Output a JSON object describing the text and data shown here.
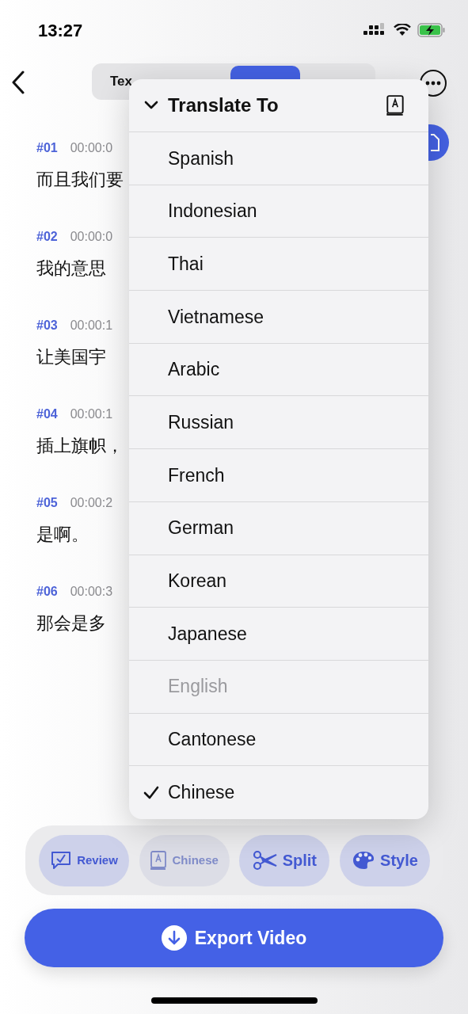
{
  "status_bar": {
    "time": "13:27"
  },
  "tabs": [
    {
      "label": "Tex",
      "selected": false
    },
    {
      "selected": true
    }
  ],
  "subtitles": [
    {
      "index": "#01",
      "time": "00:00:0",
      "text": "而且我们要"
    },
    {
      "index": "#02",
      "time": "00:00:0",
      "text": "我的意思"
    },
    {
      "index": "#03",
      "time": "00:00:1",
      "text": "让美国宇"
    },
    {
      "index": "#04",
      "time": "00:00:1",
      "text": "插上旗帜，"
    },
    {
      "index": "#05",
      "time": "00:00:2",
      "text": "是啊。"
    },
    {
      "index": "#06",
      "time": "00:00:3",
      "text": "那会是多"
    }
  ],
  "menu": {
    "title": "Translate To",
    "items": [
      {
        "label": "Spanish",
        "checked": false,
        "disabled": false
      },
      {
        "label": "Indonesian",
        "checked": false,
        "disabled": false
      },
      {
        "label": "Thai",
        "checked": false,
        "disabled": false
      },
      {
        "label": "Vietnamese",
        "checked": false,
        "disabled": false
      },
      {
        "label": "Arabic",
        "checked": false,
        "disabled": false
      },
      {
        "label": "Russian",
        "checked": false,
        "disabled": false
      },
      {
        "label": "French",
        "checked": false,
        "disabled": false
      },
      {
        "label": "German",
        "checked": false,
        "disabled": false
      },
      {
        "label": "Korean",
        "checked": false,
        "disabled": false
      },
      {
        "label": "Japanese",
        "checked": false,
        "disabled": false
      },
      {
        "label": "English",
        "checked": false,
        "disabled": true
      },
      {
        "label": "Cantonese",
        "checked": false,
        "disabled": false
      },
      {
        "label": "Chinese",
        "checked": true,
        "disabled": false
      }
    ]
  },
  "toolbar": [
    {
      "kind": "review",
      "label": "Review",
      "disabled": false
    },
    {
      "kind": "language",
      "label": "Chinese",
      "disabled": true
    },
    {
      "kind": "split",
      "label": "Split",
      "disabled": false
    },
    {
      "kind": "style",
      "label": "Style",
      "disabled": false
    }
  ],
  "export_button": {
    "label": "Export Video"
  }
}
